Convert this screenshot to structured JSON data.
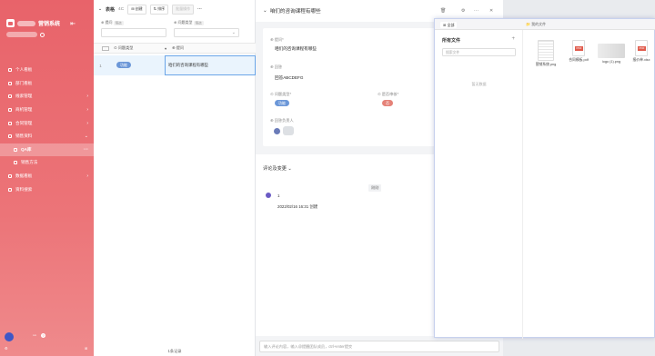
{
  "sidebar": {
    "app_name": "营销系统",
    "items": [
      {
        "label": "个人看板",
        "arrow": ""
      },
      {
        "label": "部门看板",
        "arrow": ""
      },
      {
        "label": "线索管理",
        "arrow": "›"
      },
      {
        "label": "商机管理",
        "arrow": "›"
      },
      {
        "label": "合同管理",
        "arrow": "›"
      },
      {
        "label": "销售资料",
        "arrow": "⌄"
      },
      {
        "label": "QA库",
        "arrow": "···"
      },
      {
        "label": "销售方法",
        "arrow": ""
      },
      {
        "label": "数据看板",
        "arrow": "›"
      },
      {
        "label": "资料搜索",
        "arrow": ""
      }
    ]
  },
  "table": {
    "title": "表格",
    "count": "4C",
    "btn_create": "创建",
    "btn_sort": "排序",
    "btn_batch": "批量操作",
    "more": "···",
    "filter1_label": "提问",
    "filter1_tag": "筛选",
    "filter2_label": "问题类型",
    "filter2_tag": "筛选",
    "col_type": "问题类型",
    "col_question": "提问",
    "row_index": "1",
    "row_type": "功能",
    "row_question": "咱们的咨询课程有哪些",
    "footer": "1条记录"
  },
  "detail": {
    "title": "咱们的咨询课程有哪些",
    "label_question": "提问*",
    "val_question": "咱们的咨询课程有哪些",
    "label_answer": "回答",
    "val_answer": "回答ABCDEFG",
    "label_type": "问题类型*",
    "val_type": "功能",
    "label_review": "是否审核*",
    "val_review": "否",
    "label_owner": "回答负责人",
    "comments_title": "评论及变更",
    "comments_filter": "⌄",
    "time_chip": "刚刚",
    "log_count": "1",
    "log_text": "2022/02/16 16:31 创建",
    "input_placeholder": "输入评论内容，输入@提醒团队成员，ctrl+enter提交"
  },
  "files": {
    "tab": "全部",
    "path": "我的文件",
    "left_title": "所有文件",
    "search_placeholder": "搜索文件",
    "empty": "暂无数据",
    "items": [
      {
        "name": "营销系统.png",
        "kind": "image"
      },
      {
        "name": "合同模板.pdf",
        "kind": "pdf"
      },
      {
        "name": "logo (1).png",
        "kind": "image"
      },
      {
        "name": "报价单.xlsx",
        "kind": "pdf"
      }
    ]
  },
  "colors": {
    "accent": "#e8636a",
    "badge_blue": "#6b97d8",
    "badge_red": "#e58278"
  }
}
